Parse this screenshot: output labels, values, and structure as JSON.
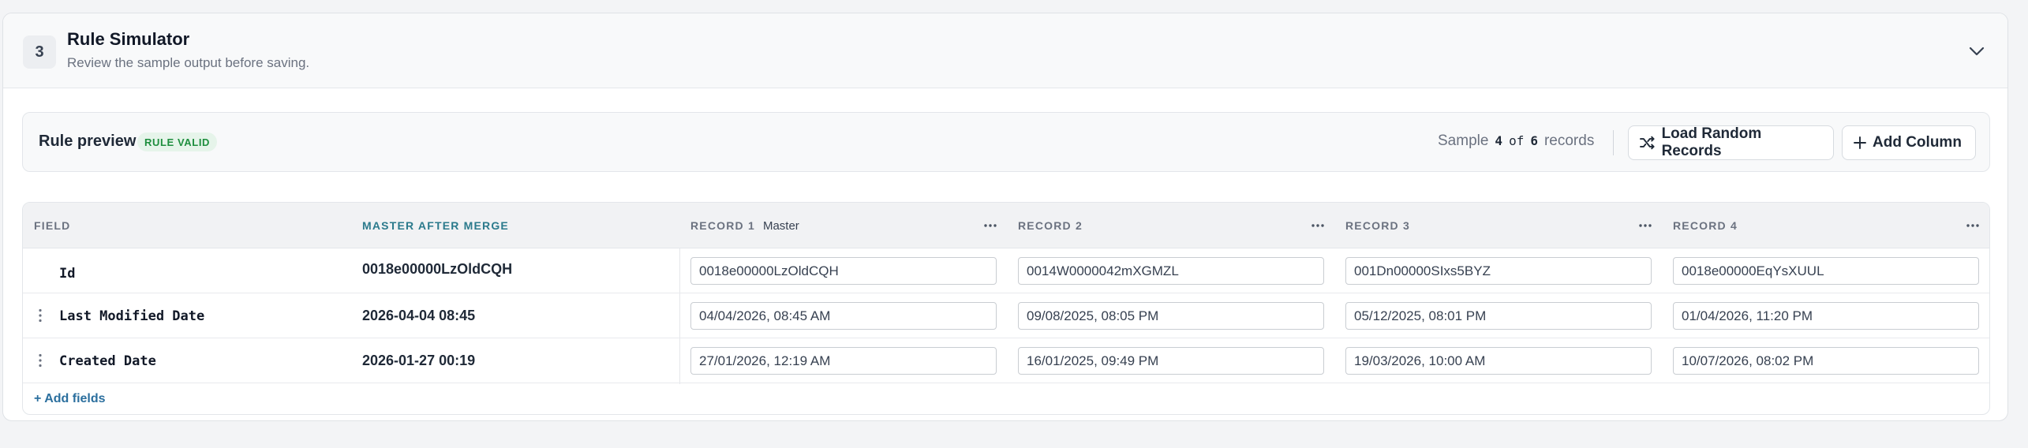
{
  "section": {
    "step": "3",
    "title": "Rule Simulator",
    "subtitle": "Review the sample output before saving."
  },
  "preview": {
    "title": "Rule preview",
    "status_badge": "RULE VALID",
    "sample_prefix": "Sample",
    "sample_current": "4",
    "sample_of": "of",
    "sample_total": "6",
    "sample_suffix": "records",
    "load_button": "Load Random Records",
    "add_column_button": "Add Column"
  },
  "table": {
    "headers": {
      "field": "FIELD",
      "master_after_merge": "MASTER AFTER MERGE",
      "record1": "RECORD 1",
      "record1_tag": "Master",
      "record2": "RECORD 2",
      "record3": "RECORD 3",
      "record4": "RECORD 4"
    },
    "rows": [
      {
        "field": "Id",
        "merge": "0018e00000LzOldCQH",
        "values": [
          "0018e00000LzOldCQH",
          "0014W0000042mXGMZL",
          "001Dn00000SIxs5BYZ",
          "0018e00000EqYsXUUL"
        ]
      },
      {
        "field": "Last Modified Date",
        "merge": "2026-04-04 08:45",
        "values": [
          "04/04/2026, 08:45 AM",
          "09/08/2025, 08:05 PM",
          "05/12/2025, 08:01 PM",
          "01/04/2026, 11:20 PM"
        ]
      },
      {
        "field": "Created Date",
        "merge": "2026-01-27 00:19",
        "values": [
          "27/01/2026, 12:19 AM",
          "16/01/2025, 09:49 PM",
          "19/03/2026, 10:00 AM",
          "10/07/2026, 08:02 PM"
        ]
      }
    ],
    "add_fields": "+ Add fields"
  },
  "colors": {
    "accent_teal": "#2b7a8c",
    "valid_green": "#1e8e3e",
    "link_blue": "#2b6f9e"
  },
  "icons": {
    "collapse": "chevron-down-icon",
    "load": "shuffle-icon",
    "add": "plus-icon",
    "column_menu": "more-horizontal-icon",
    "drag": "drag-vertical-icon"
  }
}
